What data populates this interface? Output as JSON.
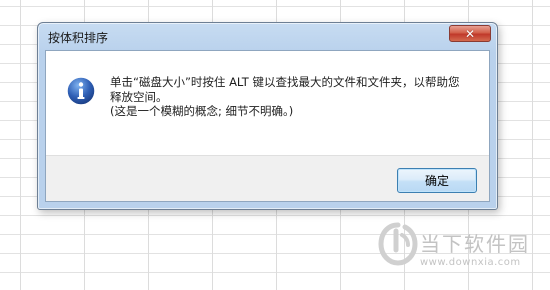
{
  "dialog": {
    "title": "按体积排序",
    "close_label": "✕",
    "message_lines": [
      "单击“磁盘大小”时按住 ALT 键以查找最大的文件和文件夹，以帮助您",
      "释放空间。",
      "(这是一个模糊的概念; 细节不明确。)"
    ],
    "ok_label": "确定",
    "icon": "info-icon"
  },
  "watermark": {
    "brand": "当下软件园",
    "url": "www.downxia.com"
  },
  "colors": {
    "titlebar": "#b9d1ec",
    "close_button": "#c0392b",
    "info_icon": "#2f5fb5",
    "footer": "#f0f0f0"
  }
}
